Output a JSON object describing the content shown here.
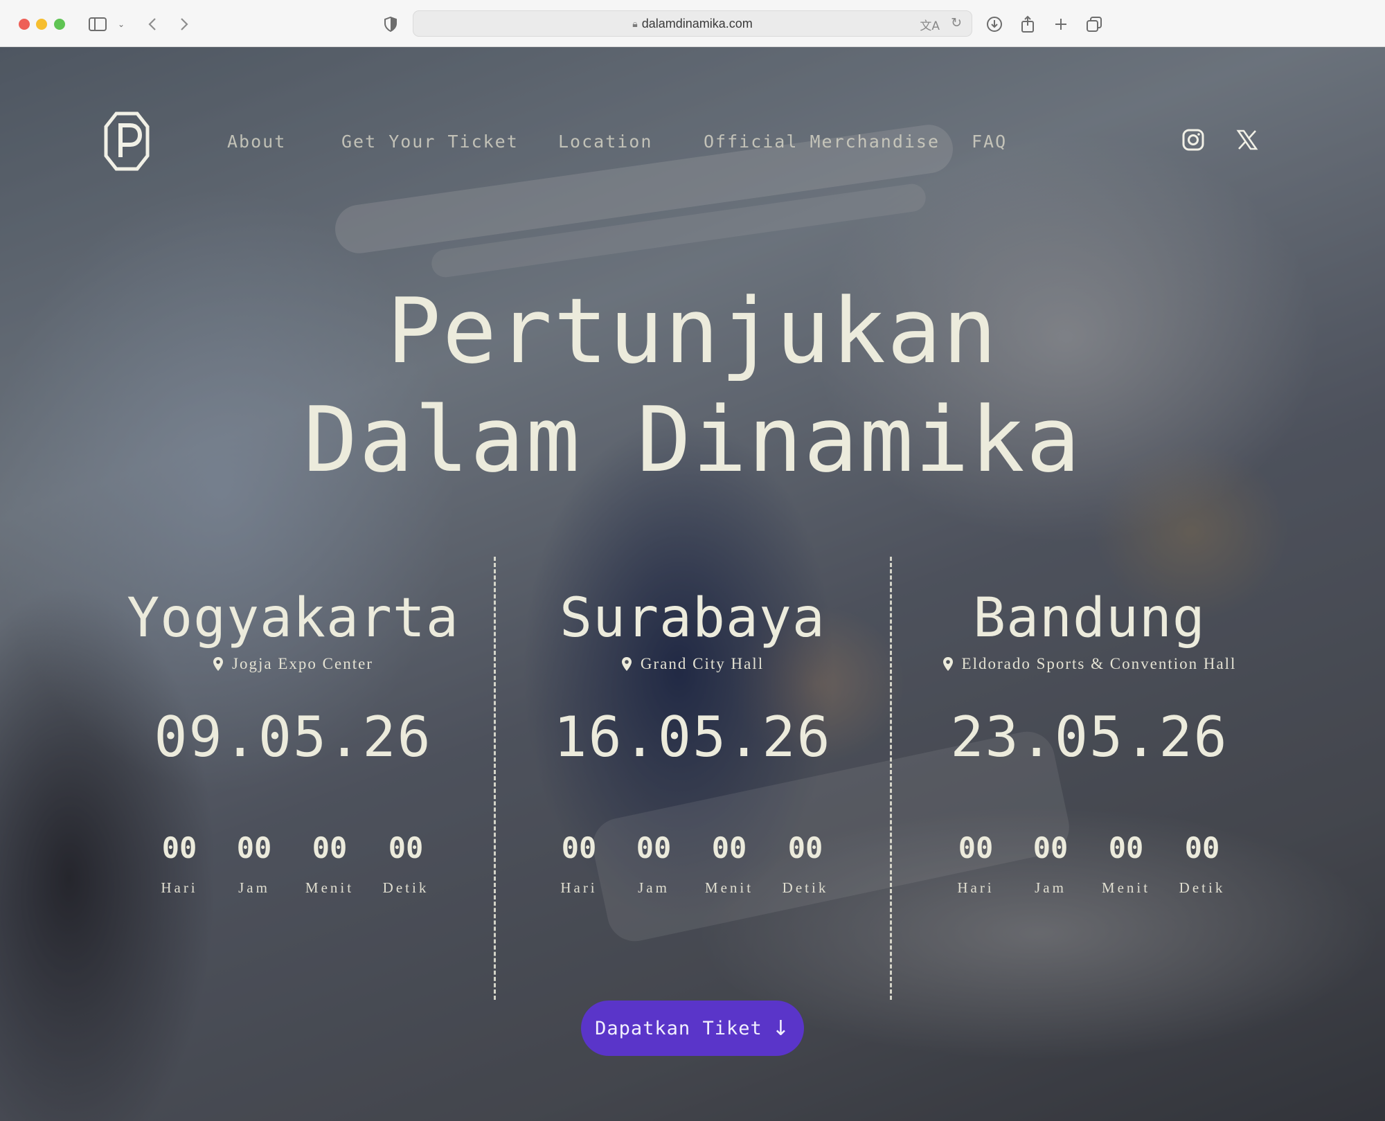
{
  "browser": {
    "url": "dalamdinamika.com"
  },
  "nav": {
    "items": [
      {
        "label": "About"
      },
      {
        "label": "Get Your Ticket"
      },
      {
        "label": "Location"
      },
      {
        "label": "Official Merchandise"
      },
      {
        "label": "FAQ"
      }
    ],
    "social": [
      "instagram-icon",
      "x-icon"
    ]
  },
  "hero": {
    "title_line1": "Pertunjukan",
    "title_line2": "Dalam Dinamika"
  },
  "events": [
    {
      "city": "Yogyakarta",
      "venue": "Jogja Expo Center",
      "date": "09.05.26",
      "countdown": [
        {
          "value": "00",
          "label": "Hari"
        },
        {
          "value": "00",
          "label": "Jam"
        },
        {
          "value": "00",
          "label": "Menit"
        },
        {
          "value": "00",
          "label": "Detik"
        }
      ]
    },
    {
      "city": "Surabaya",
      "venue": "Grand City Hall",
      "date": "16.05.26",
      "countdown": [
        {
          "value": "00",
          "label": "Hari"
        },
        {
          "value": "00",
          "label": "Jam"
        },
        {
          "value": "00",
          "label": "Menit"
        },
        {
          "value": "00",
          "label": "Detik"
        }
      ]
    },
    {
      "city": "Bandung",
      "venue": "Eldorado Sports & Convention Hall",
      "date": "23.05.26",
      "countdown": [
        {
          "value": "00",
          "label": "Hari"
        },
        {
          "value": "00",
          "label": "Jam"
        },
        {
          "value": "00",
          "label": "Menit"
        },
        {
          "value": "00",
          "label": "Detik"
        }
      ]
    }
  ],
  "cta": {
    "label": "Dapatkan Tiket",
    "icon": "arrow-down-icon"
  },
  "colors": {
    "accent": "#5a35c9",
    "text": "#ecebdc"
  }
}
